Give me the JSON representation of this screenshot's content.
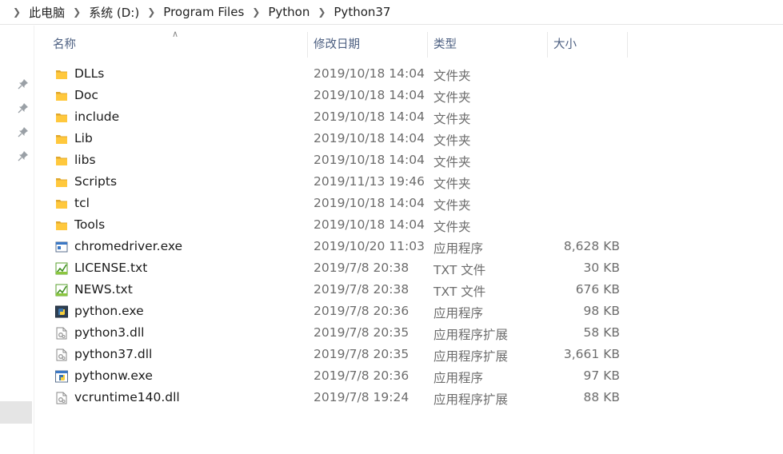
{
  "breadcrumb": [
    "此电脑",
    "系统 (D:)",
    "Program Files",
    "Python",
    "Python37"
  ],
  "columns": {
    "name": "名称",
    "date": "修改日期",
    "type": "类型",
    "size": "大小"
  },
  "files": [
    {
      "name": "DLLs",
      "date": "2019/10/18 14:04",
      "type": "文件夹",
      "size": "",
      "icon": "folder-icon"
    },
    {
      "name": "Doc",
      "date": "2019/10/18 14:04",
      "type": "文件夹",
      "size": "",
      "icon": "folder-icon"
    },
    {
      "name": "include",
      "date": "2019/10/18 14:04",
      "type": "文件夹",
      "size": "",
      "icon": "folder-icon"
    },
    {
      "name": "Lib",
      "date": "2019/10/18 14:04",
      "type": "文件夹",
      "size": "",
      "icon": "folder-icon"
    },
    {
      "name": "libs",
      "date": "2019/10/18 14:04",
      "type": "文件夹",
      "size": "",
      "icon": "folder-icon"
    },
    {
      "name": "Scripts",
      "date": "2019/11/13 19:46",
      "type": "文件夹",
      "size": "",
      "icon": "folder-icon"
    },
    {
      "name": "tcl",
      "date": "2019/10/18 14:04",
      "type": "文件夹",
      "size": "",
      "icon": "folder-icon"
    },
    {
      "name": "Tools",
      "date": "2019/10/18 14:04",
      "type": "文件夹",
      "size": "",
      "icon": "folder-icon"
    },
    {
      "name": "chromedriver.exe",
      "date": "2019/10/20 11:03",
      "type": "应用程序",
      "size": "8,628 KB",
      "icon": "exe-icon"
    },
    {
      "name": "LICENSE.txt",
      "date": "2019/7/8 20:38",
      "type": "TXT 文件",
      "size": "30 KB",
      "icon": "txt-icon"
    },
    {
      "name": "NEWS.txt",
      "date": "2019/7/8 20:38",
      "type": "TXT 文件",
      "size": "676 KB",
      "icon": "txt-icon"
    },
    {
      "name": "python.exe",
      "date": "2019/7/8 20:36",
      "type": "应用程序",
      "size": "98 KB",
      "icon": "python-icon"
    },
    {
      "name": "python3.dll",
      "date": "2019/7/8 20:35",
      "type": "应用程序扩展",
      "size": "58 KB",
      "icon": "dll-icon"
    },
    {
      "name": "python37.dll",
      "date": "2019/7/8 20:35",
      "type": "应用程序扩展",
      "size": "3,661 KB",
      "icon": "dll-icon"
    },
    {
      "name": "pythonw.exe",
      "date": "2019/7/8 20:36",
      "type": "应用程序",
      "size": "97 KB",
      "icon": "pythonw-icon"
    },
    {
      "name": "vcruntime140.dll",
      "date": "2019/7/8 19:24",
      "type": "应用程序扩展",
      "size": "88 KB",
      "icon": "dll-icon"
    }
  ]
}
